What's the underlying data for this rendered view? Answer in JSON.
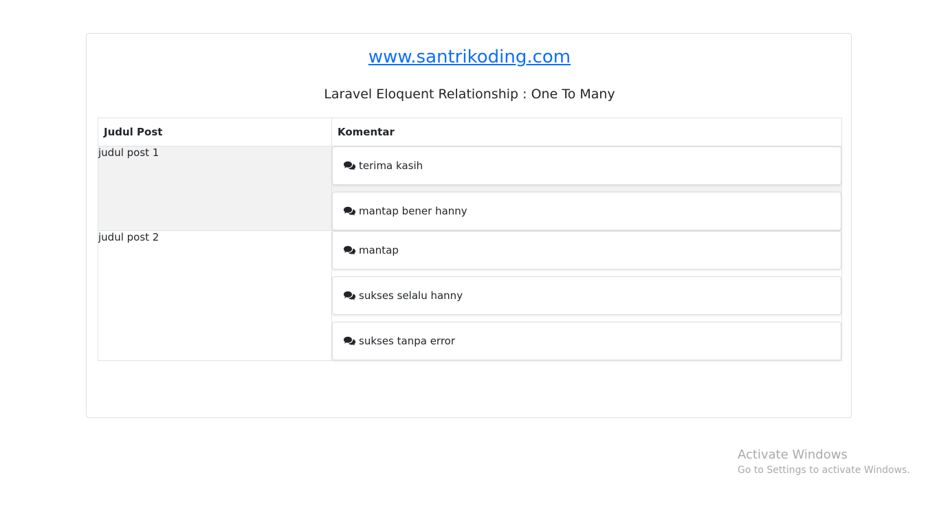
{
  "header": {
    "site_link": "www.santrikoding.com",
    "subtitle": "Laravel Eloquent Relationship : One To Many"
  },
  "table": {
    "columns": [
      "Judul Post",
      "Komentar"
    ],
    "rows": [
      {
        "title": "judul post 1",
        "comments": [
          "terima kasih",
          "mantap bener hanny"
        ]
      },
      {
        "title": "judul post 2",
        "comments": [
          "mantap",
          "sukses selalu hanny",
          "sukses tanpa error"
        ]
      }
    ]
  },
  "icons": {
    "comment": "comments-icon"
  },
  "colors": {
    "link": "#0d6efd",
    "stripe": "#f2f2f2",
    "border": "#dee2e6"
  },
  "watermark": {
    "line1": "Activate Windows",
    "line2": "Go to Settings to activate Windows."
  }
}
